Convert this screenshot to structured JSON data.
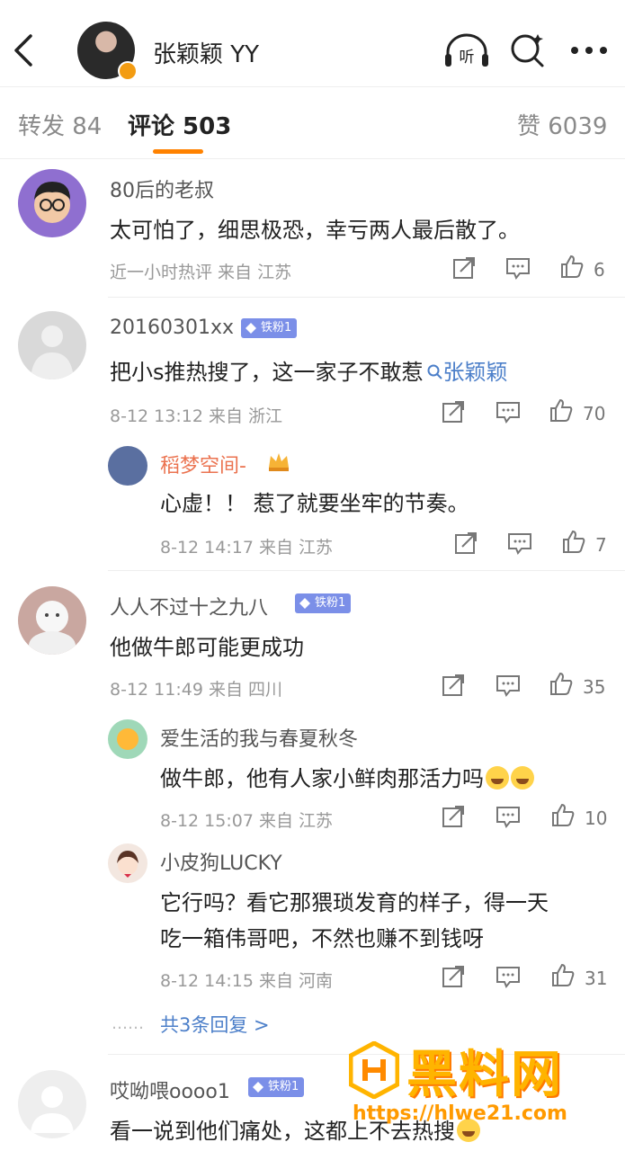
{
  "header": {
    "name": "张颖颖 YY",
    "listen_label": "听"
  },
  "tabs": [
    {
      "label": "转发 84"
    },
    {
      "label": "评论 503"
    },
    {
      "label": "赞 6039"
    }
  ],
  "comments": [
    {
      "username": "80后的老叔",
      "text": "太可怕了，细思极恐，幸亏两人最后散了。",
      "meta": "近一小时热评  来自 江苏",
      "likes": "6"
    },
    {
      "username": "20160301xx",
      "badge": "铁粉1",
      "text": "把小s推热搜了，这一家子不敢惹",
      "topic_link": "张颖颖",
      "meta": "8-12 13:12  来自 浙江",
      "likes": "70",
      "replies": [
        {
          "username": "稻梦空间-",
          "text": "心虚！！ 惹了就要坐牢的节奏。",
          "meta": "8-12 14:17  来自 江苏",
          "likes": "7"
        }
      ]
    },
    {
      "username": "人人不过十之九八",
      "badge": "铁粉1",
      "text": "他做牛郎可能更成功",
      "meta": "8-12 11:49  来自 四川",
      "likes": "35",
      "replies": [
        {
          "username": "爱生活的我与春夏秋冬",
          "text": "做牛郎，他有人家小鲜肉那活力吗",
          "meta": "8-12 15:07  来自 江苏",
          "likes": "10"
        },
        {
          "username": "小皮狗LUCKY",
          "text_line1": "它行吗？看它那猥琐发育的样子，得一天",
          "text_line2": "吃一箱伟哥吧，不然也赚不到钱呀",
          "meta": "8-12 14:15  来自 河南",
          "likes": "31"
        }
      ],
      "more_replies": "共3条回复 >",
      "more_dots": "……"
    },
    {
      "username": "哎呦喂oooo1",
      "badge": "铁粉1",
      "text": "看一说到他们痛处，这都上不去热搜"
    }
  ],
  "watermark": {
    "title": "黑料网",
    "url": "https://hlwe21.com"
  },
  "colors": {
    "accent": "#ff8200",
    "link": "#4c7fc9",
    "badge": "#7b8fe8"
  }
}
